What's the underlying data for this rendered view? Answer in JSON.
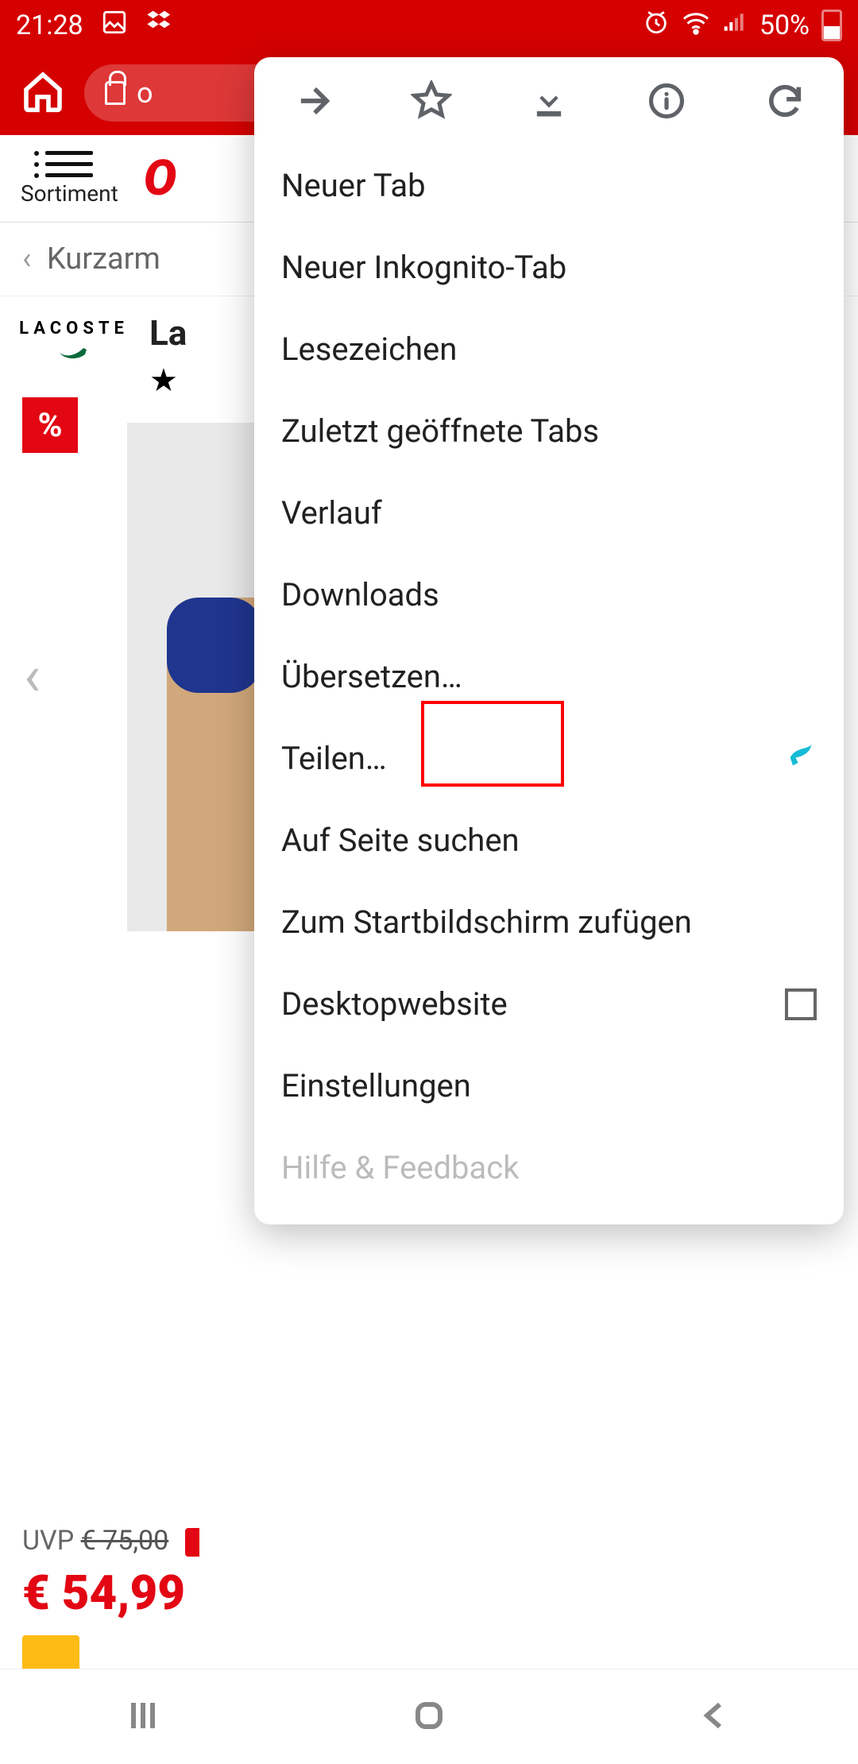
{
  "statusbar": {
    "time": "21:28",
    "battery_pct": "50%"
  },
  "browser": {
    "url_prefix": "o"
  },
  "shop": {
    "sortiment_label": "Sortiment",
    "logo_text": "O",
    "breadcrumb": "Kurzarm",
    "brand": "LACOSTE",
    "product_title_fragment": "La",
    "sale_badge": "%",
    "uvp_label": "UVP",
    "uvp_price": "€ 75,00",
    "price": "€ 54,99"
  },
  "menu": {
    "items": [
      "Neuer Tab",
      "Neuer Inkognito-Tab",
      "Lesezeichen",
      "Zuletzt geöffnete Tabs",
      "Verlauf",
      "Downloads",
      "Übersetzen…",
      "Teilen…",
      "Auf Seite suchen",
      "Zum Startbildschirm zufügen",
      "Desktopwebsite",
      "Einstellungen",
      "Hilfe & Feedback"
    ],
    "highlighted_index": 7
  },
  "colors": {
    "brand_red": "#d50000",
    "otto_red": "#e30613",
    "accent_cyan": "#15bcd4"
  }
}
